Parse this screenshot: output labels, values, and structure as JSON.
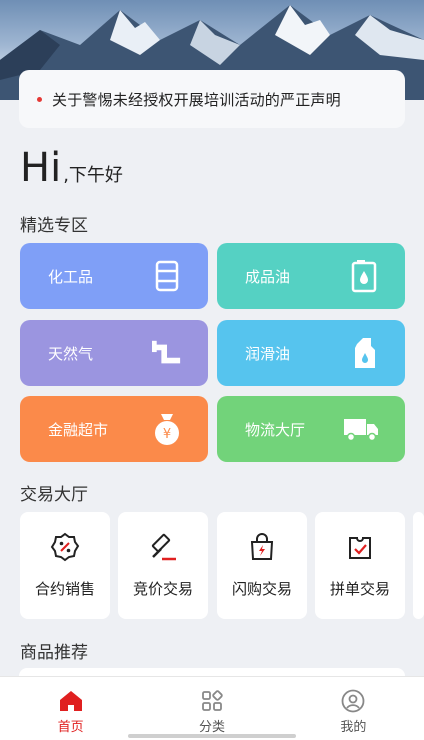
{
  "notice": {
    "text": "关于警惕未经授权开展培训活动的严正声明"
  },
  "greeting": {
    "hi": "Hi",
    "sub": ",下午好"
  },
  "sections": {
    "featured": "精选专区",
    "trading": "交易大厅",
    "recommend": "商品推荐"
  },
  "featured": [
    {
      "label": "化工品",
      "color": "#7f9ff7",
      "icon": "chemical-barrel-icon"
    },
    {
      "label": "成品油",
      "color": "#55d1c3",
      "icon": "fuel-can-icon"
    },
    {
      "label": "天然气",
      "color": "#9b95e0",
      "icon": "gas-pipe-icon"
    },
    {
      "label": "润滑油",
      "color": "#56c4ee",
      "icon": "lubricant-bottle-icon"
    },
    {
      "label": "金融超市",
      "color": "#fb8a4a",
      "icon": "money-bag-icon"
    },
    {
      "label": "物流大厅",
      "color": "#72d37a",
      "icon": "truck-icon"
    }
  ],
  "trading": [
    {
      "label": "合约销售",
      "icon": "contract-discount-icon"
    },
    {
      "label": "竞价交易",
      "icon": "auction-gavel-icon"
    },
    {
      "label": "闪购交易",
      "icon": "flash-bag-icon"
    },
    {
      "label": "拼单交易",
      "icon": "group-order-icon"
    }
  ],
  "tabbar": [
    {
      "label": "首页",
      "icon": "home-icon",
      "active": true
    },
    {
      "label": "分类",
      "icon": "category-icon",
      "active": false
    },
    {
      "label": "我的",
      "icon": "profile-icon",
      "active": false
    }
  ],
  "colors": {
    "accent": "#e02020"
  }
}
